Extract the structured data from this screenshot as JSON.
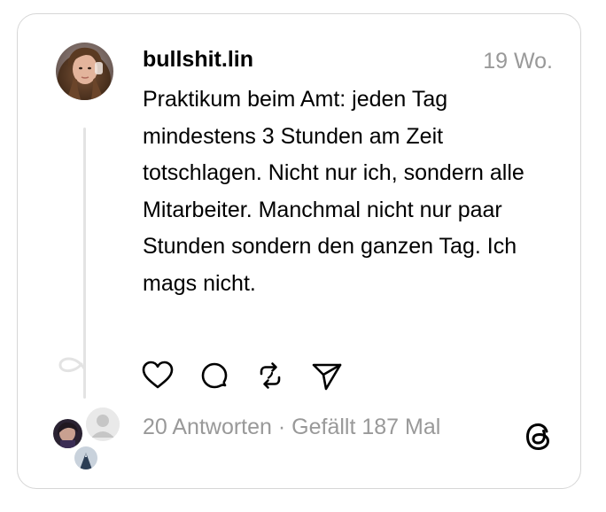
{
  "post": {
    "username": "bullshit.lin",
    "timestamp": "19 Wo.",
    "text": "Praktikum beim Amt: jeden Tag mindestens 3 Stunden am Zeit totschlagen. Nicht nur ich, sondern alle Mitarbeiter. Manchmal nicht nur paar Stunden sondern den ganzen Tag. Ich mags nicht.",
    "stats": "20 Antworten · Gefällt 187 Mal"
  },
  "actions": [
    {
      "name": "like",
      "icon": "heart-icon"
    },
    {
      "name": "reply",
      "icon": "comment-icon"
    },
    {
      "name": "repost",
      "icon": "repost-icon"
    },
    {
      "name": "share",
      "icon": "send-icon"
    }
  ],
  "icons": {
    "brand": "threads-logo-icon"
  },
  "colors": {
    "text": "#000000",
    "muted": "#999999",
    "border": "#d6d6d6",
    "thread_line": "#e3e3e3"
  }
}
